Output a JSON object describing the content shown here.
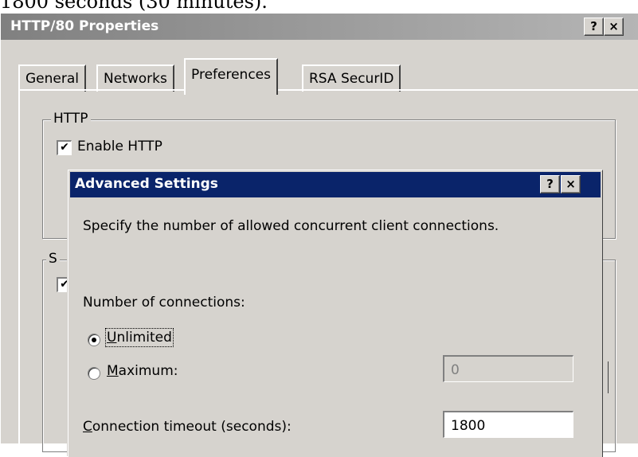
{
  "caption": "1800 seconds (30 minutes).",
  "properties": {
    "title": "HTTP/80 Properties",
    "help_label": "?",
    "close_label": "×",
    "tabs": [
      "General",
      "Networks",
      "Preferences",
      "RSA SecurID"
    ],
    "selected_tab": "Preferences",
    "http_group": {
      "label": "HTTP",
      "enable_http_label": "Enable HTTP",
      "enable_http_checked": true
    },
    "second_group": {
      "label": "S",
      "checkbox_checked": true
    }
  },
  "advanced": {
    "title": "Advanced Settings",
    "help_label": "?",
    "close_label": "×",
    "description": "Specify the number of allowed concurrent client connections.",
    "connections_label": "Number of connections:",
    "unlimited_label_accel": "U",
    "unlimited_label_rest": "nlimited",
    "maximum_label_accel": "M",
    "maximum_label_rest": "aximum:",
    "selected_option": "Unlimited",
    "maximum_value": "0",
    "timeout_label_accel": "C",
    "timeout_label_rest": "onnection timeout (seconds):",
    "timeout_value": "1800"
  },
  "colors": {
    "active_title": "#0a246a",
    "inactive_title": "#808080",
    "face": "#d6d3ce"
  }
}
